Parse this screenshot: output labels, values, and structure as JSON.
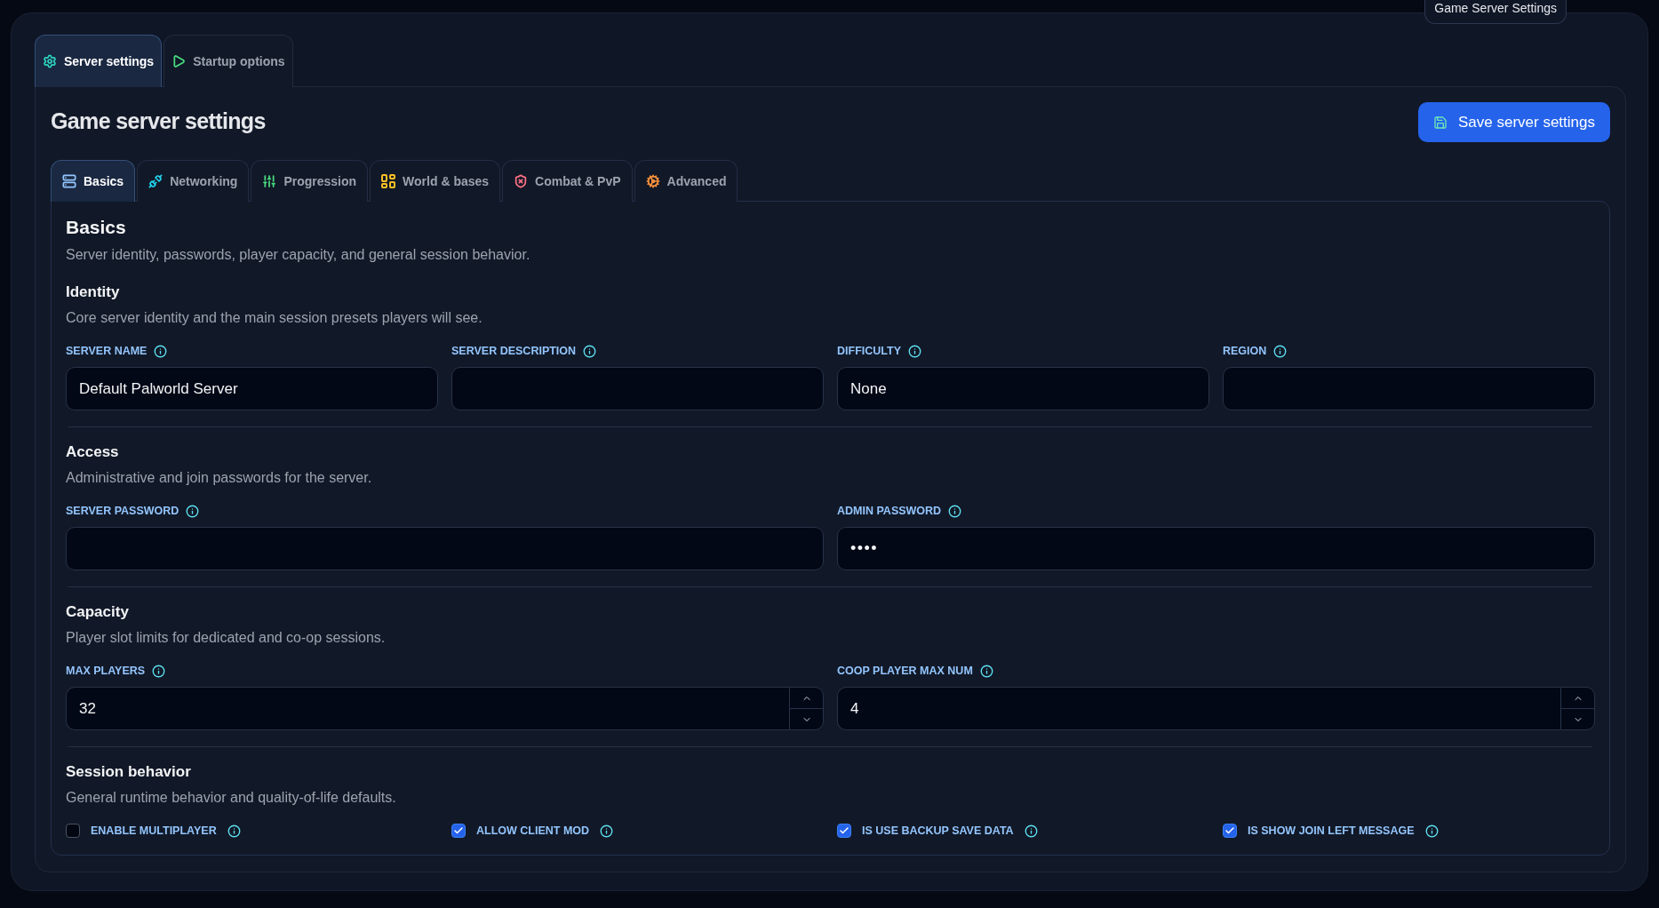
{
  "tooltip": "Game Server Settings",
  "top_tabs": [
    {
      "label": "Server settings",
      "selected": true,
      "color": "#2dd4bf"
    },
    {
      "label": "Startup options",
      "selected": false,
      "color": "#4ade80"
    }
  ],
  "title": "Game server settings",
  "save_button": "Save server settings",
  "section_tabs": [
    {
      "label": "Basics",
      "selected": true,
      "color": "#93c5fd"
    },
    {
      "label": "Networking",
      "selected": false,
      "color": "#22d3ee"
    },
    {
      "label": "Progression",
      "selected": false,
      "color": "#4ade80"
    },
    {
      "label": "World & bases",
      "selected": false,
      "color": "#fbbf24"
    },
    {
      "label": "Combat & PvP",
      "selected": false,
      "color": "#fb7185"
    },
    {
      "label": "Advanced",
      "selected": false,
      "color": "#fb923c"
    }
  ],
  "section": {
    "title": "Basics",
    "description": "Server identity, passwords, player capacity, and general session behavior.",
    "groups": [
      {
        "title": "Identity",
        "description": "Core server identity and the main session presets players will see.",
        "fields": [
          {
            "kind": "text",
            "label": "SERVER NAME",
            "value": "Default Palworld Server"
          },
          {
            "kind": "text",
            "label": "SERVER DESCRIPTION"
          },
          {
            "kind": "text",
            "label": "DIFFICULTY",
            "value": "None"
          },
          {
            "kind": "text",
            "label": "REGION"
          }
        ]
      },
      {
        "title": "Access",
        "description": "Administrative and join passwords for the server.",
        "fields": [
          {
            "kind": "password",
            "label": "SERVER PASSWORD"
          },
          {
            "kind": "password",
            "label": "ADMIN PASSWORD",
            "value": "••••"
          }
        ]
      },
      {
        "title": "Capacity",
        "description": "Player slot limits for dedicated and co-op sessions.",
        "fields": [
          {
            "kind": "number",
            "label": "MAX PLAYERS",
            "value": "32"
          },
          {
            "kind": "number",
            "label": "COOP PLAYER MAX NUM",
            "value": "4"
          }
        ]
      },
      {
        "title": "Session behavior",
        "description": "General runtime behavior and quality-of-life defaults.",
        "checkboxes": [
          {
            "label": "ENABLE MULTIPLAYER",
            "checked": false
          },
          {
            "label": "ALLOW CLIENT MOD",
            "checked": true
          },
          {
            "label": "IS USE BACKUP SAVE DATA",
            "checked": true
          },
          {
            "label": "IS SHOW JOIN LEFT MESSAGE",
            "checked": true
          }
        ]
      }
    ]
  }
}
